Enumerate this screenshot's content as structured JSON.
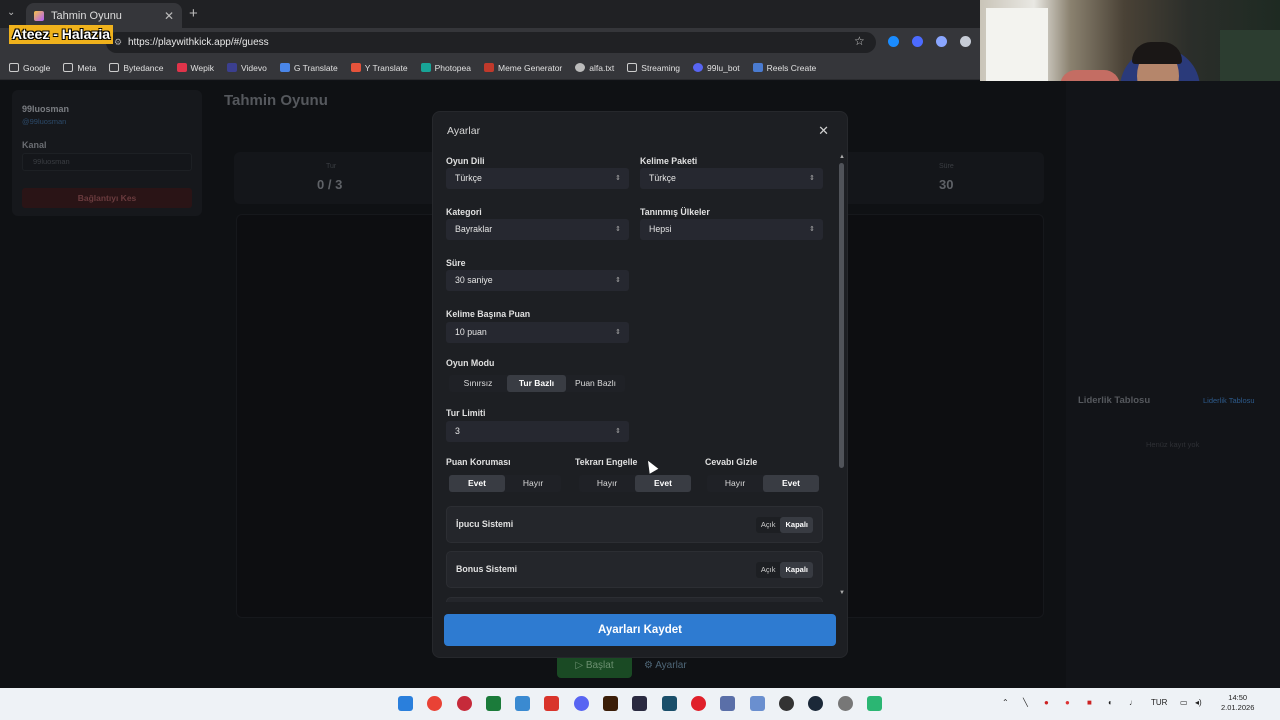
{
  "browser": {
    "tab_title": "Tahmin Oyunu",
    "tab_close": "✕",
    "new_tab": "+",
    "url": "https://playwithkick.app/#/guess",
    "bookmarks": [
      "Google",
      "Meta",
      "Bytedance",
      "Wepik",
      "Videvo",
      "G Translate",
      "Y Translate",
      "Photopea",
      "Meme Generator",
      "alfa.txt",
      "Streaming",
      "99lu_bot",
      "Reels Create"
    ]
  },
  "overlay": {
    "now_playing": "Ateez - Halazia"
  },
  "page": {
    "title": "Tahmin Oyunu",
    "left_panel": {
      "username": "99luosman",
      "username_sub": "@99luosman",
      "kanal_label": "Kanal",
      "kanal_placeholder": "99luosman",
      "disconnect_button": "Bağlantıyı Kes"
    },
    "stats": {
      "round_label": "Tur",
      "round_value": "0 / 3",
      "time_label": "Süre",
      "time_value": "30"
    },
    "leaderboard": {
      "title": "Liderlik Tablosu",
      "link": "Liderlik Tablosu",
      "empty": "Henüz kayıt yok"
    },
    "actions": {
      "start": "▷ Başlat",
      "settings": "⚙ Ayarlar"
    }
  },
  "modal": {
    "title": "Ayarlar",
    "close": "✕",
    "game_language": {
      "label": "Oyun Dili",
      "value": "Türkçe"
    },
    "word_pack": {
      "label": "Kelime Paketi",
      "value": "Türkçe"
    },
    "category": {
      "label": "Kategori",
      "value": "Bayraklar"
    },
    "recognized_countries": {
      "label": "Tanınmış Ülkeler",
      "value": "Hepsi"
    },
    "duration": {
      "label": "Süre",
      "value": "30 saniye"
    },
    "points_per_word": {
      "label": "Kelime Başına Puan",
      "value": "10 puan"
    },
    "game_mode": {
      "label": "Oyun Modu",
      "options": [
        "Sınırsız",
        "Tur Bazlı",
        "Puan Bazlı"
      ],
      "selected": "Tur Bazlı"
    },
    "round_limit": {
      "label": "Tur Limiti",
      "value": "3"
    },
    "score_protection": {
      "label": "Puan Koruması",
      "options": [
        "Evet",
        "Hayır"
      ],
      "selected": "Evet"
    },
    "block_repeat": {
      "label": "Tekrarı Engelle",
      "options": [
        "Hayır",
        "Evet"
      ],
      "selected": "Evet"
    },
    "hide_answer": {
      "label": "Cevabı Gizle",
      "options": [
        "Hayır",
        "Evet"
      ],
      "selected": "Evet"
    },
    "hint_system": {
      "label": "İpucu Sistemi",
      "on": "Açık",
      "off": "Kapalı",
      "selected": "Kapalı"
    },
    "bonus_system": {
      "label": "Bonus Sistemi",
      "on": "Açık",
      "off": "Kapalı",
      "selected": "Kapalı"
    },
    "save_button": "Ayarları Kaydet"
  },
  "taskbar": {
    "language": "TUR",
    "time": "14:50",
    "date": "2.01.2026"
  }
}
